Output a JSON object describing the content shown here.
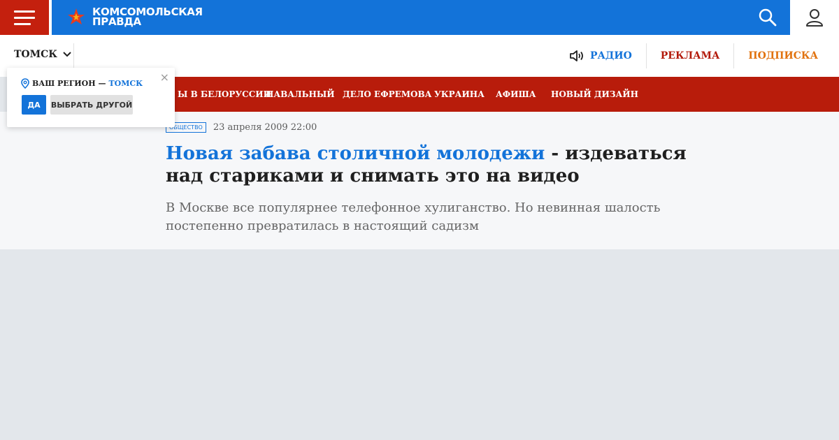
{
  "header": {
    "logo_line1": "КОМСОМОЛЬСКАЯ",
    "logo_line2": "ПРАВДА",
    "menu_icon": "hamburger-menu-icon",
    "search_icon": "search-icon",
    "user_icon": "user-icon",
    "colors": {
      "red": "#c4200e",
      "blue": "#1373d9"
    }
  },
  "region": {
    "current": "ТОМСК"
  },
  "right_nav": {
    "radio": "РАДИО",
    "ads": "РЕКЛАМА",
    "subscribe": "ПОДПИСКА"
  },
  "red_nav": {
    "items": [
      "Ы В БЕЛОРУССИИ",
      "НАВАЛЬНЫЙ",
      "ДЕЛО ЕФРЕМОВА",
      "УКРАИНА",
      "АФИША",
      "НОВЫЙ ДИЗАЙН"
    ]
  },
  "article": {
    "tag": "ОБЩЕСТВО",
    "date": "23 апреля 2009 22:00",
    "title_highlight": "Новая забава столичной молодежи",
    "title_rest": " - издеваться над стариками и снимать это на видео",
    "lead": "В Москве все популярнее телефонное хулиганство. Но невинная шалость постепенно превратилась в настоящий садизм"
  },
  "popup": {
    "label": "ВАШ РЕГИОН —",
    "city": "ТОМСК",
    "yes": "ДА",
    "other": "ВЫБРАТЬ ДРУГОЙ",
    "close": "×"
  }
}
